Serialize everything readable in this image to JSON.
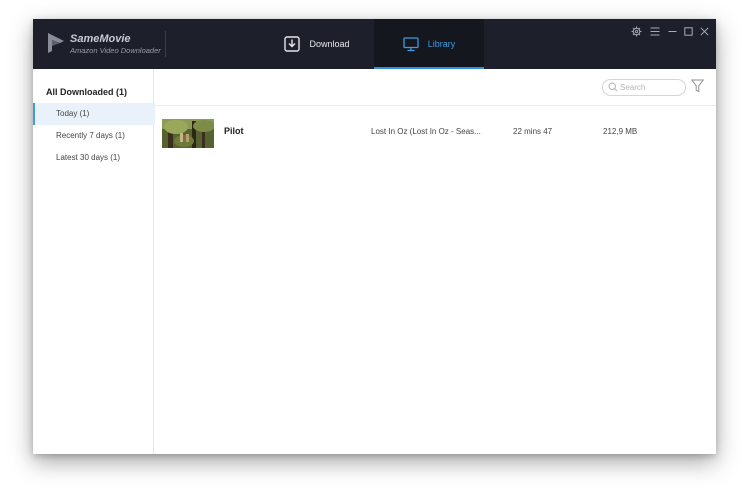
{
  "app": {
    "name": "SameMovie",
    "subtitle": "Amazon Video Downloader"
  },
  "tabs": [
    {
      "label": "Download",
      "icon": "download-icon"
    },
    {
      "label": "Library",
      "icon": "monitor-icon"
    }
  ],
  "window_controls": [
    "gear-icon",
    "menu-icon",
    "minimize-icon",
    "maximize-icon",
    "close-icon"
  ],
  "sidebar": {
    "header": "All Downloaded (1)",
    "items": [
      {
        "label": "Today (1)",
        "active": true
      },
      {
        "label": "Recently 7 days (1)",
        "active": false
      },
      {
        "label": "Latest 30 days (1)",
        "active": false
      }
    ]
  },
  "search": {
    "placeholder": "Search",
    "value": ""
  },
  "list": [
    {
      "title": "Pilot",
      "series": "Lost In Oz (Lost In Oz - Seas...",
      "duration": "22 mins 47",
      "size": "212,9 MB"
    }
  ],
  "colors": {
    "titlebar": "#1d1f2b",
    "accent": "#3d9be0",
    "active_tab_bg": "#15171f"
  }
}
